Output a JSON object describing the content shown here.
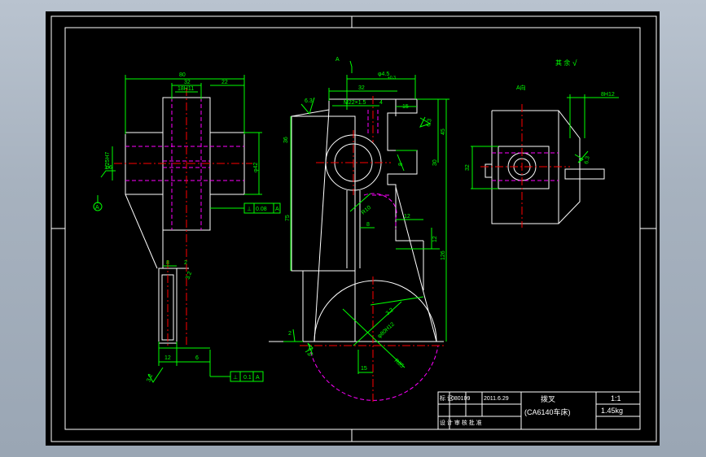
{
  "colors": {
    "background": "#000000",
    "frame": "#ffffff",
    "outline": "#ffffff",
    "dimension": "#00ff00",
    "centerline": "#ff0000",
    "hidden": "#ff00ff",
    "window": "#a9b4c1"
  },
  "side_view": {
    "dims": [
      "80",
      "32",
      "22",
      "18H11",
      "φ25H7",
      "1.6",
      "φ42",
      "8",
      "2",
      "3.2",
      "12",
      "6",
      "3.2"
    ],
    "datum": "A",
    "tol_top": {
      "symbol": "⊥",
      "value": "0.08",
      "datum": "A"
    },
    "tol_bottom": {
      "symbol": "⊥",
      "value": "0.1",
      "datum": "A"
    }
  },
  "front_view": {
    "section_label": "A",
    "dims": [
      "φ4.5",
      "+0.3",
      "32",
      "6.3",
      "M22×1.5",
      "4",
      "15",
      "6.3",
      "36",
      "45",
      "30",
      "8",
      "75",
      "R10",
      "8",
      "12",
      "12",
      "126",
      "3.2",
      "φ80H12",
      "2",
      "R85",
      "15",
      "6.3"
    ]
  },
  "roughness_note": {
    "text": "其 余",
    "symbol": "√"
  },
  "aux_view": {
    "title": "A向",
    "dims": [
      "8H12",
      "32",
      "6.3"
    ]
  },
  "title_block": {
    "row1_left": "标 记",
    "row1_num": "080109",
    "row1_date": "2011.6.29",
    "row2_left": "设 计 审 核 批 准",
    "part_name": "拨叉",
    "part_sub": "(CA6140车床)",
    "scale": "1:1",
    "weight": "1.45kg"
  }
}
